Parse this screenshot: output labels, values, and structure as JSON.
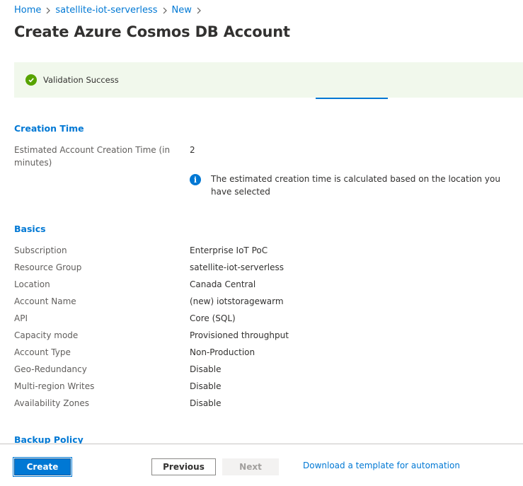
{
  "breadcrumb": {
    "items": [
      "Home",
      "satellite-iot-serverless",
      "New"
    ]
  },
  "page": {
    "title": "Create Azure Cosmos DB Account"
  },
  "validation": {
    "message": "Validation Success",
    "status_color": "#57a300"
  },
  "sections": {
    "creation_time": {
      "heading": "Creation Time",
      "label": "Estimated Account Creation Time (in minutes)",
      "value": "2",
      "info": "The estimated creation time is calculated based on the location you have selected"
    },
    "basics": {
      "heading": "Basics",
      "rows": [
        {
          "label": "Subscription",
          "value": "Enterprise IoT PoC"
        },
        {
          "label": "Resource Group",
          "value": "satellite-iot-serverless"
        },
        {
          "label": "Location",
          "value": "Canada Central"
        },
        {
          "label": "Account Name",
          "value": "(new) iotstoragewarm"
        },
        {
          "label": "API",
          "value": "Core (SQL)"
        },
        {
          "label": "Capacity mode",
          "value": "Provisioned throughput"
        },
        {
          "label": "Account Type",
          "value": "Non-Production"
        },
        {
          "label": "Geo-Redundancy",
          "value": "Disable"
        },
        {
          "label": "Multi-region Writes",
          "value": "Disable"
        },
        {
          "label": "Availability Zones",
          "value": "Disable"
        }
      ]
    },
    "backup_policy": {
      "heading": "Backup Policy"
    }
  },
  "footer": {
    "create_label": "Create",
    "previous_label": "Previous",
    "next_label": "Next",
    "download_link": "Download a template for automation"
  },
  "colors": {
    "accent": "#0078d4",
    "success_bg": "#f1f8ec"
  }
}
